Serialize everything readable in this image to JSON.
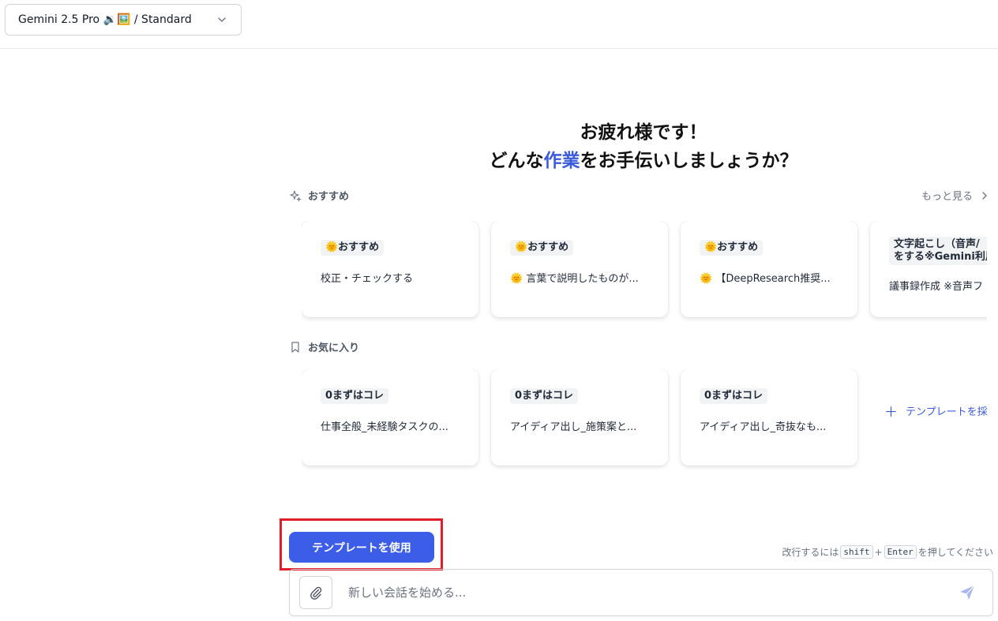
{
  "header": {
    "model_label": "Gemini 2.5 Pro 🔉🖼️ / Standard"
  },
  "greeting": {
    "line1": "お疲れ様です！",
    "line2_pre": "どんな",
    "line2_accent": "作業",
    "line2_post": "をお手伝いしましょうか？"
  },
  "recommended": {
    "title": "おすすめ",
    "more_label": "もっと見る",
    "cards": [
      {
        "tag": "🌞おすすめ",
        "text": "校正・チェックする"
      },
      {
        "tag": "🌞おすすめ",
        "text": "🌞 言葉で説明したものが..."
      },
      {
        "tag": "🌞おすすめ",
        "text": "🌞 【DeepResearch推奨..."
      },
      {
        "tag_line1": "文字起こし（音声/",
        "tag_line2": "をする※Gemini利用",
        "text": "議事録作成 ※音声フ"
      }
    ]
  },
  "favorites": {
    "title": "お気に入り",
    "cards": [
      {
        "tag": "0まずはコレ",
        "text": "仕事全般_未経験タスクの..."
      },
      {
        "tag": "0まずはコレ",
        "text": "アイディア出し_施策案と..."
      },
      {
        "tag": "0まずはコレ",
        "text": "アイディア出し_奇抜なも..."
      }
    ],
    "add_label": "テンプレートを採"
  },
  "composer": {
    "use_template_label": "テンプレートを使用",
    "hint_prefix": "改行するには",
    "hint_key1": "shift",
    "hint_plus": "+",
    "hint_key2": "Enter",
    "hint_suffix": "を押してください",
    "placeholder": "新しい会話を始める...",
    "accent_color": "#3b5de7",
    "highlight_color": "#e11d2a"
  }
}
